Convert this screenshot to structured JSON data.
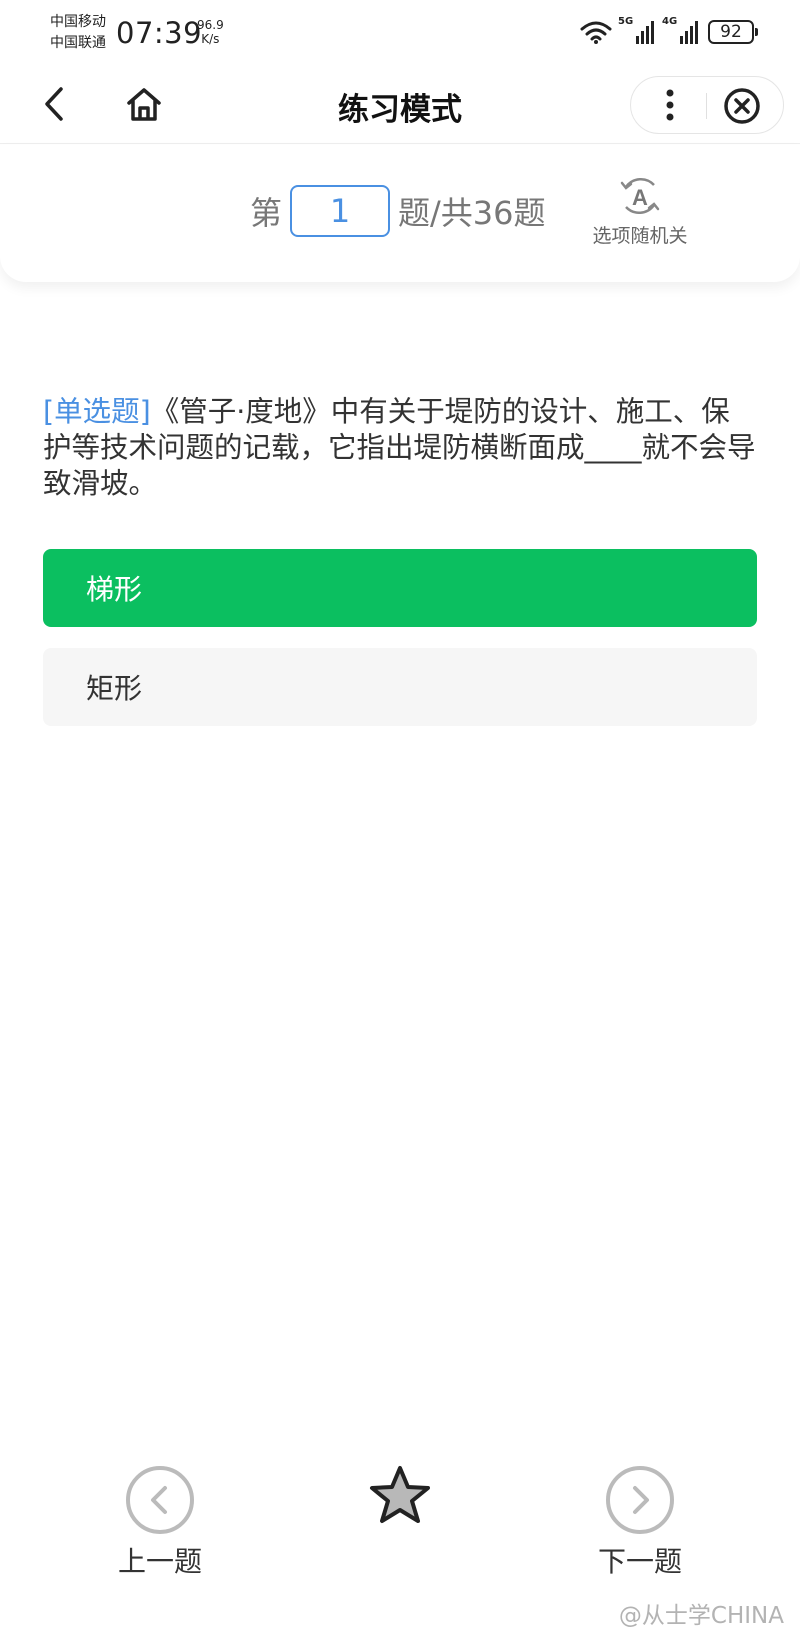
{
  "status_bar": {
    "carrier_1": "中国移动",
    "carrier_2": "中国联通",
    "time": "07:39",
    "speed_value": "96.9",
    "speed_unit": "K/s",
    "signal_1_gen": "5G",
    "signal_2_gen": "4G",
    "battery": "92"
  },
  "navbar": {
    "title": "练习模式",
    "icons": [
      "back-arrow-icon",
      "home-icon",
      "more-vertical-icon",
      "close-circle-icon"
    ]
  },
  "question_header": {
    "prefix": "第",
    "current_number": "1",
    "suffix": "题/共36题",
    "shuffle_icon_letter": "A",
    "shuffle_label": "选项随机关"
  },
  "question": {
    "type_label": "[单选题]",
    "text": "《管子·度地》中有关于堤防的设计、施工、保护等技术问题的记载，它指出堤防横断面成____就不会导致滑坡。"
  },
  "options": [
    {
      "label": "梯形",
      "selected": true
    },
    {
      "label": "矩形",
      "selected": false
    }
  ],
  "colors": {
    "accent_blue": "#4a90e2",
    "selected_green": "#0bbf60",
    "option_bg": "#f6f6f6"
  },
  "bottom_bar": {
    "prev_label": "上一题",
    "next_label": "下一题",
    "star_icon": "star-icon"
  },
  "watermark": "@从士学CHINA"
}
